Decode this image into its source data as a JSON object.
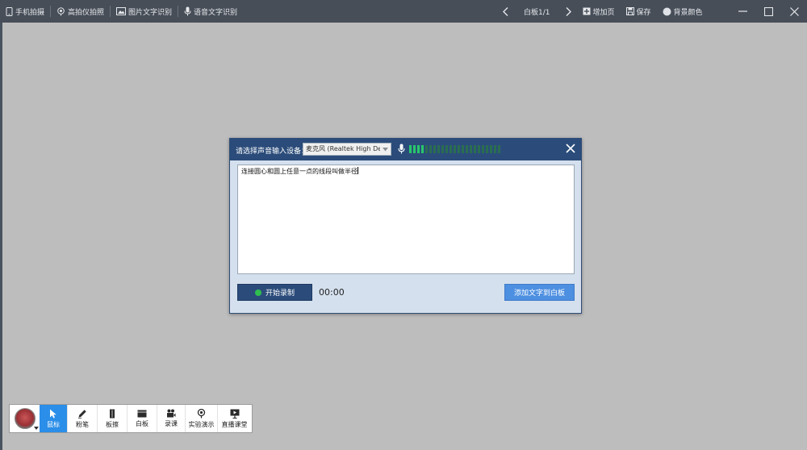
{
  "toolbar": {
    "items": [
      {
        "label": "手机拍摄",
        "icon": "phone-icon"
      },
      {
        "label": "高拍仪拍照",
        "icon": "camera-pin-icon"
      },
      {
        "label": "图片文字识别",
        "icon": "image-text-icon"
      },
      {
        "label": "语音文字识别",
        "icon": "microphone-icon"
      }
    ],
    "page_label": "白板1/1",
    "add_page": "增加页",
    "save": "保存",
    "bg_color": "背景颜色"
  },
  "dialog": {
    "device_label": "请选择声音输入设备：",
    "device_value": "麦克风 (Realtek High Definition Audio)",
    "text_value": "连接圆心和圆上任意一点的线段叫做半径",
    "record_button": "开始录制",
    "timer": "00:00",
    "add_button": "添加文字到白板",
    "meter_levels_on": 4,
    "meter_levels_total": 23
  },
  "bottombar": {
    "items": [
      {
        "label": "鼠标",
        "icon": "cursor-icon",
        "active": true
      },
      {
        "label": "粉笔",
        "icon": "chalk-icon",
        "active": false
      },
      {
        "label": "板擦",
        "icon": "eraser-icon",
        "active": false
      },
      {
        "label": "白板",
        "icon": "whiteboard-icon",
        "active": false
      },
      {
        "label": "录课",
        "icon": "video-camera-icon",
        "active": false
      },
      {
        "label": "实验演示",
        "icon": "experiment-icon",
        "active": false
      },
      {
        "label": "直播课堂",
        "icon": "live-class-icon",
        "active": false
      }
    ]
  },
  "colors": {
    "toolbar_bg": "#474e58",
    "canvas_bg": "#bdbdbd",
    "dialog_header": "#2b4c7a",
    "dialog_body": "#d5e0ee",
    "accent_blue": "#4d8fe0",
    "active_tool": "#2b8ee8",
    "meter_green": "#29c76b"
  }
}
